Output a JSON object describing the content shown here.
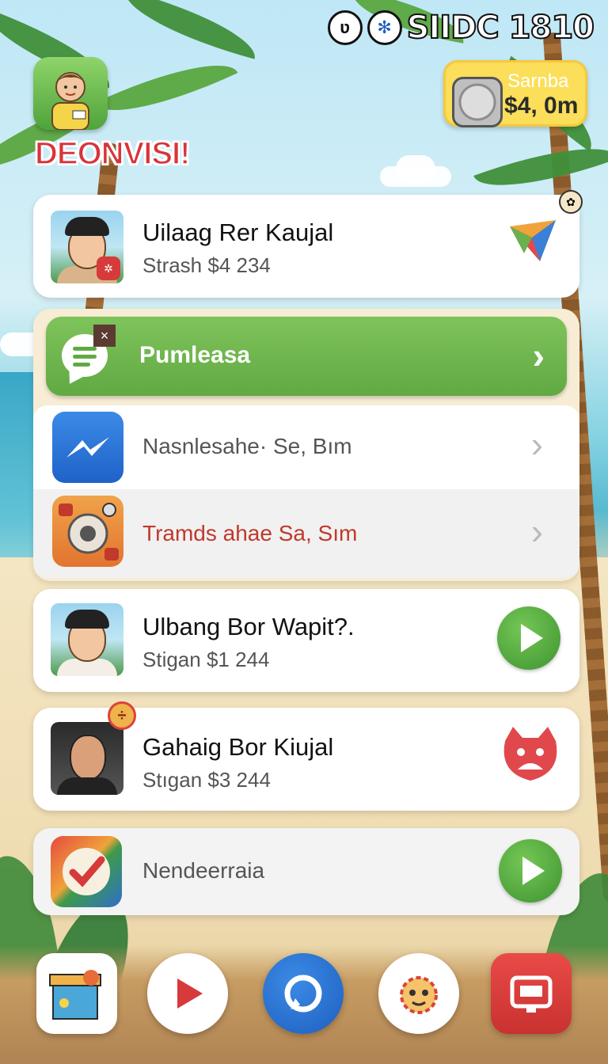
{
  "status_bar": {
    "icon_1": "alien-icon",
    "icon_2": "snowflake-icon",
    "text": "SIIDC 1810"
  },
  "header": {
    "app_title": "DEONVISI!"
  },
  "balance": {
    "label": "Sarnba",
    "value": "$4, 0m"
  },
  "items": [
    {
      "title": "Uilaag Rer Kaujal",
      "subtitle": "Strash $4 234",
      "action_icon": "paper-plane-icon"
    },
    {
      "title": "Ulbang Bor Wapit?.",
      "subtitle": "Stigan $1 244",
      "action_icon": "play-icon"
    },
    {
      "title": "Gahaig Bor Kiujal",
      "subtitle": "Stıgan $3 244",
      "action_icon": "mascot-icon"
    }
  ],
  "group": {
    "header_label": "Pumleasa",
    "rows": [
      {
        "label": "Nasnlesahe· Se, Bım",
        "label_color": "#555555"
      },
      {
        "label": "Tramds ahae Sa, Sım",
        "label_color": "#c0392b"
      }
    ]
  },
  "bottom_item": {
    "label": "Nendeerraia"
  },
  "dock": [
    "toybox-icon",
    "video-play-icon",
    "compass-icon",
    "sun-mascot-icon",
    "tv-icon"
  ],
  "colors": {
    "accent_green": "#61a943",
    "title_red": "#d8343a",
    "balance_yellow": "#fbde5a"
  }
}
